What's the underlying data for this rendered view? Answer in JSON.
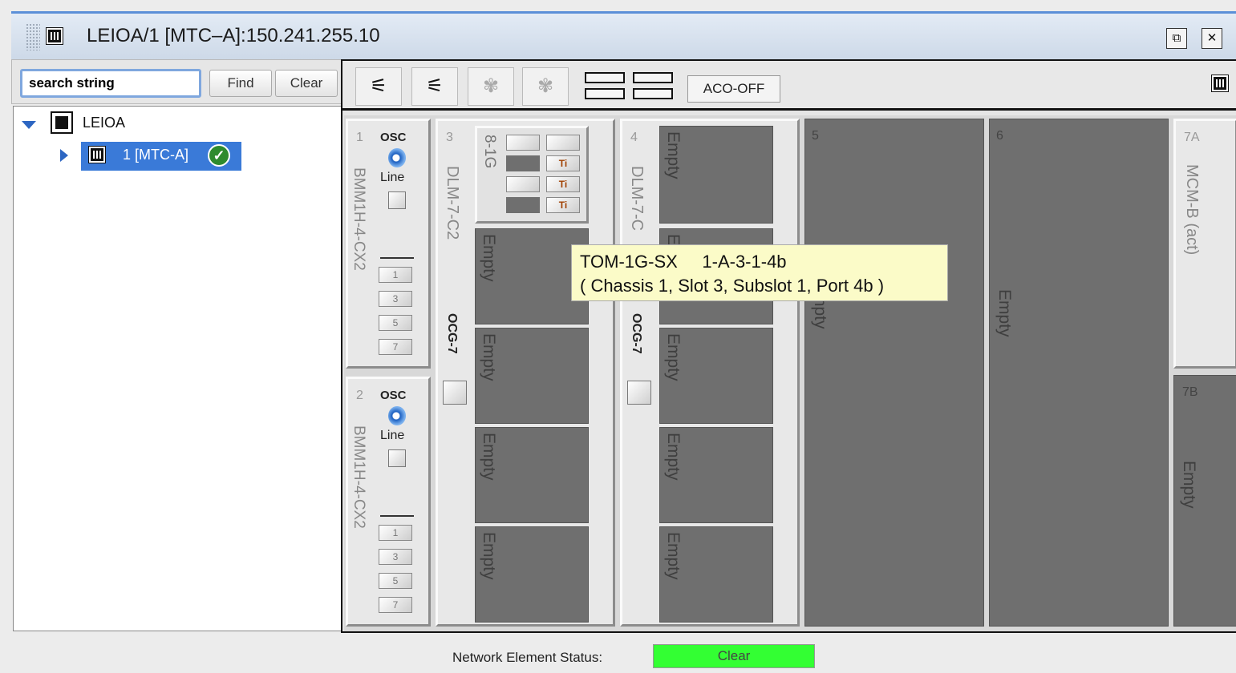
{
  "window": {
    "title": "LEIOA/1 [MTC–A]:150.241.255.10",
    "restore_glyph": "⧉",
    "close_glyph": "✕"
  },
  "search": {
    "value": "search string",
    "find_label": "Find",
    "clear_label": "Clear"
  },
  "tree": {
    "root_label": "LEIOA",
    "child_label": "1 [MTC-A]",
    "child_status_icon": "check-circle-icon"
  },
  "toolbar": {
    "aco_label": "ACO-OFF",
    "buttons": [
      "plug-connect-icon",
      "plug-disconnect-icon",
      "fan-icon",
      "fan-icon",
      "layout-grid-icon"
    ]
  },
  "shelf": {
    "slot1": {
      "num": "1",
      "osc": "OSC",
      "line": "Line",
      "card_name": "BMM1H-4-CX2",
      "ports": [
        "1",
        "3",
        "5",
        "7"
      ]
    },
    "slot2": {
      "num": "2",
      "osc": "OSC",
      "line": "Line",
      "card_name": "BMM1H-4-CX2",
      "ports": [
        "1",
        "3",
        "5",
        "7"
      ]
    },
    "slot3": {
      "num": "3",
      "card_name": "DLM-7-C2",
      "ocg": "OCG-7",
      "sub1_name": "8-1G",
      "sub2": "Empty",
      "sub3": "Empty",
      "sub4": "Empty",
      "sub5": "Empty"
    },
    "slot4": {
      "num": "4",
      "card_name": "DLM-7-C",
      "ocg": "OCG-7",
      "sub1": "Empty",
      "sub2": "E",
      "sub3": "Empty",
      "sub4": "Empty",
      "sub5": "Empty"
    },
    "slot5": {
      "num": "5",
      "label": "mpty"
    },
    "slot6": {
      "num": "6",
      "label": "Empty"
    },
    "slot7a": {
      "num": "7A",
      "card_name": "MCM-B  (act)"
    },
    "slot7b": {
      "num": "7B",
      "label": "Empty"
    }
  },
  "tooltip": {
    "line1": "TOM-1G-SX     1-A-3-1-4b",
    "line2": "( Chassis 1, Slot 3, Subslot 1, Port 4b )"
  },
  "status": {
    "label": "Network Element Status:",
    "value": "Clear",
    "value_color": "#33ff33"
  }
}
